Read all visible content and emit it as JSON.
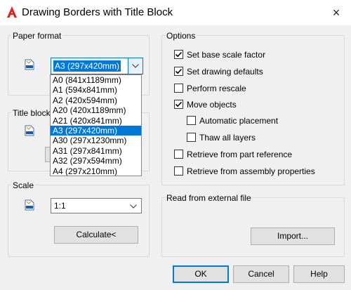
{
  "window": {
    "title": "Drawing Borders with Title Block",
    "close_glyph": "×"
  },
  "paper_format": {
    "label": "Paper format",
    "selected": "A3 (297x420mm)",
    "options": [
      "A0 (841x1189mm)",
      "A1 (594x841mm)",
      "A2 (420x594mm)",
      "A20 (420x1189mm)",
      "A21 (420x841mm)",
      "A3 (297x420mm)",
      "A30 (297x1230mm)",
      "A31 (297x841mm)",
      "A32 (297x594mm)",
      "A4 (297x210mm)"
    ],
    "selected_index": 5
  },
  "title_block": {
    "label": "Title block"
  },
  "scale": {
    "label": "Scale",
    "value": "1:1",
    "calculate_label": "Calculate<"
  },
  "options": {
    "label": "Options",
    "items": [
      {
        "label": "Set base scale factor",
        "checked": true
      },
      {
        "label": "Set drawing defaults",
        "checked": true
      },
      {
        "label": "Perform rescale",
        "checked": false
      },
      {
        "label": "Move objects",
        "checked": true
      },
      {
        "label": "Automatic placement",
        "checked": false
      },
      {
        "label": "Thaw all layers",
        "checked": false
      },
      {
        "label": "Retrieve from part reference",
        "checked": false
      },
      {
        "label": "Retrieve from assembly properties",
        "checked": false
      }
    ]
  },
  "external": {
    "label": "Read from external file",
    "import_label": "Import..."
  },
  "footer": {
    "ok_label": "OK",
    "cancel_label": "Cancel",
    "help_label": "Help"
  },
  "colors": {
    "accent": "#0078d7",
    "logo": "#e2231a",
    "background": "#f0f0f0"
  }
}
